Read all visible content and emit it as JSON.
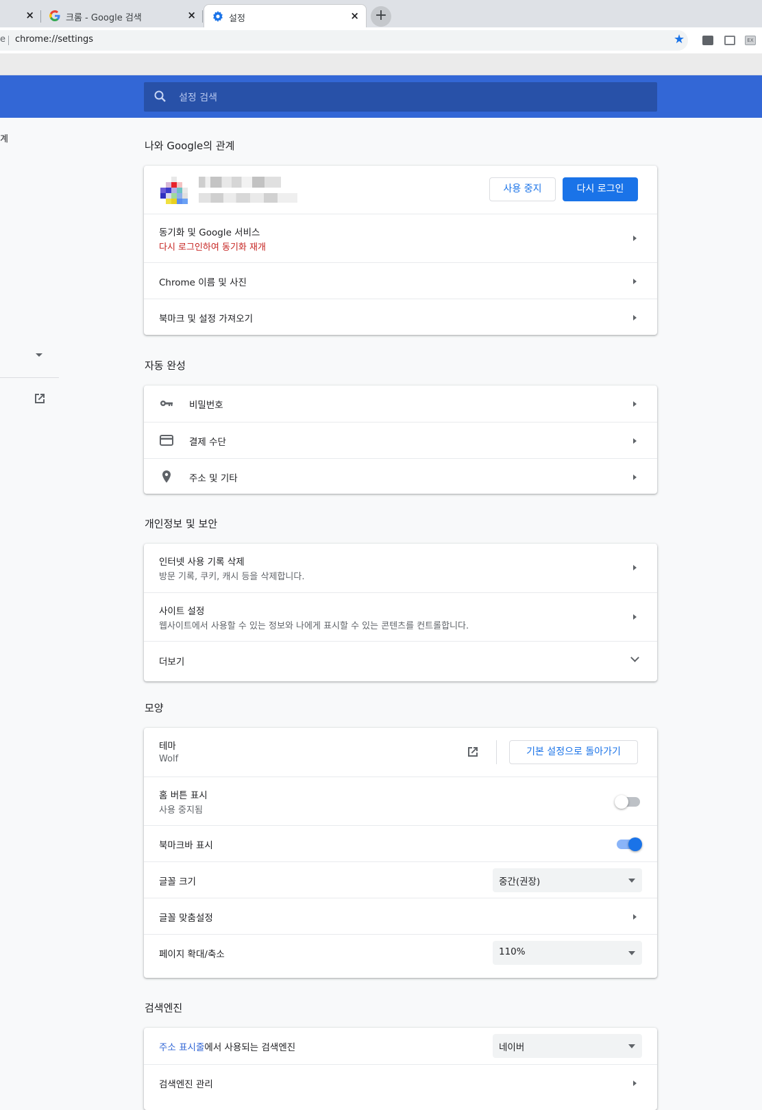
{
  "browser": {
    "tabs": [
      {
        "title": "",
        "active": false
      },
      {
        "title": "크롬 - Google 검색",
        "active": false,
        "favicon": "google-g-icon"
      },
      {
        "title": "설정",
        "active": true,
        "favicon": "gear-icon"
      }
    ],
    "tab_close_glyph": "×",
    "new_tab_glyph": "+",
    "omnibox_prefix": "e",
    "url": "chrome://settings",
    "bookmark_star_icon": "star-icon",
    "extension_icons": [
      "extension-info-icon",
      "extension-window-icon",
      "extension-ex-icon"
    ],
    "ext3_label": "EX"
  },
  "header": {
    "search_placeholder": "설정 검색"
  },
  "sidebar": {
    "fragment_text": "계"
  },
  "colors": {
    "header_blue": "#3367d6",
    "accent": "#1a73e8",
    "error": "#c5221f"
  },
  "sections": {
    "you_google": {
      "title": "나와 Google의 관계",
      "stop_button": "사용 중지",
      "signin_button": "다시 로그인",
      "sync_label": "동기화 및 Google 서비스",
      "sync_sub": "다시 로그인하여 동기화 재개",
      "chrome_name_label": "Chrome 이름 및 사진",
      "import_label": "북마크 및 설정 가져오기"
    },
    "autofill": {
      "title": "자동 완성",
      "passwords": "비밀번호",
      "payments": "결제 수단",
      "addresses": "주소 및 기타"
    },
    "privacy": {
      "title": "개인정보 및 보안",
      "clear_label": "인터넷 사용 기록 삭제",
      "clear_sub": "방문 기록, 쿠키, 캐시 등을 삭제합니다.",
      "site_label": "사이트 설정",
      "site_sub": "웹사이트에서 사용할 수 있는 정보와 나에게 표시할 수 있는 콘텐츠를 컨트롤합니다.",
      "more_label": "더보기"
    },
    "appearance": {
      "title": "모양",
      "theme_label": "테마",
      "theme_value": "Wolf",
      "reset_button": "기본 설정으로 돌아가기",
      "home_label": "홈 버튼 표시",
      "home_sub": "사용 중지됨",
      "home_enabled": false,
      "bookmarks_bar_label": "북마크바 표시",
      "bookmarks_bar_enabled": true,
      "font_size_label": "글꼴 크기",
      "font_size_value": "중간(권장)",
      "customize_fonts_label": "글꼴 맞춤설정",
      "zoom_label": "페이지 확대/축소",
      "zoom_value": "110%"
    },
    "search_engine": {
      "title": "검색엔진",
      "engine_label_link": "주소 표시줄",
      "engine_label_rest": "에서 사용되는 검색엔진",
      "engine_value": "네이버",
      "manage_label": "검색엔진 관리"
    }
  }
}
